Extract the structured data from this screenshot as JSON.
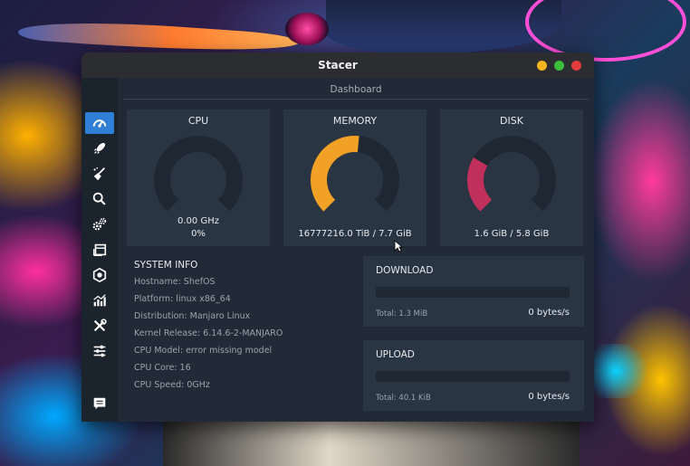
{
  "window": {
    "title": "Stacer",
    "controls": {
      "minimize_color": "#f5b51f",
      "maximize_color": "#3cc03c",
      "close_color": "#e23c3c"
    }
  },
  "page": {
    "title": "Dashboard"
  },
  "sidebar": {
    "accent_color": "#2f7fd6",
    "items": [
      {
        "icon": "dashboard-gauge-icon",
        "active": true
      },
      {
        "icon": "rocket-icon",
        "active": false
      },
      {
        "icon": "broom-icon",
        "active": false
      },
      {
        "icon": "search-icon",
        "active": false
      },
      {
        "icon": "gears-icon",
        "active": false
      },
      {
        "icon": "packages-icon",
        "active": false
      },
      {
        "icon": "resources-icon",
        "active": false
      },
      {
        "icon": "bar-chart-icon",
        "active": false
      },
      {
        "icon": "tools-icon",
        "active": false
      },
      {
        "icon": "sliders-icon",
        "active": false
      },
      {
        "icon": "feedback-icon",
        "active": false
      }
    ]
  },
  "gauges": {
    "cpu": {
      "label": "CPU",
      "value_line1": "0.00 GHz",
      "value_line2": "0%",
      "percent": 0,
      "color": "#2f7fd6"
    },
    "memory": {
      "label": "MEMORY",
      "value_line1": "16777216.0 TiB / 7.7 GiB",
      "percent": 0.52,
      "color": "#f2a127"
    },
    "disk": {
      "label": "DISK",
      "value_line1": "1.6 GiB / 5.8 GiB",
      "percent": 0.28,
      "color": "#c1305c"
    }
  },
  "system_info": {
    "title": "SYSTEM INFO",
    "rows": [
      "Hostname: ShefOS",
      "Platform: linux x86_64",
      "Distribution: Manjaro Linux",
      "Kernel Release: 6.14.6-2-MANJARO",
      "CPU Model: error missing model",
      "CPU Core: 16",
      "CPU Speed: 0GHz"
    ]
  },
  "network": {
    "download": {
      "label": "DOWNLOAD",
      "total": "Total: 1.3 MiB",
      "speed": "0 bytes/s",
      "usage": 0
    },
    "upload": {
      "label": "UPLOAD",
      "total": "Total: 40.1 KiB",
      "speed": "0 bytes/s",
      "usage": 0
    }
  },
  "colors": {
    "window_bg": "#212a36",
    "card_bg": "#2a3543",
    "gauge_track": "#1f2832",
    "accent": "#2f7fd6"
  }
}
